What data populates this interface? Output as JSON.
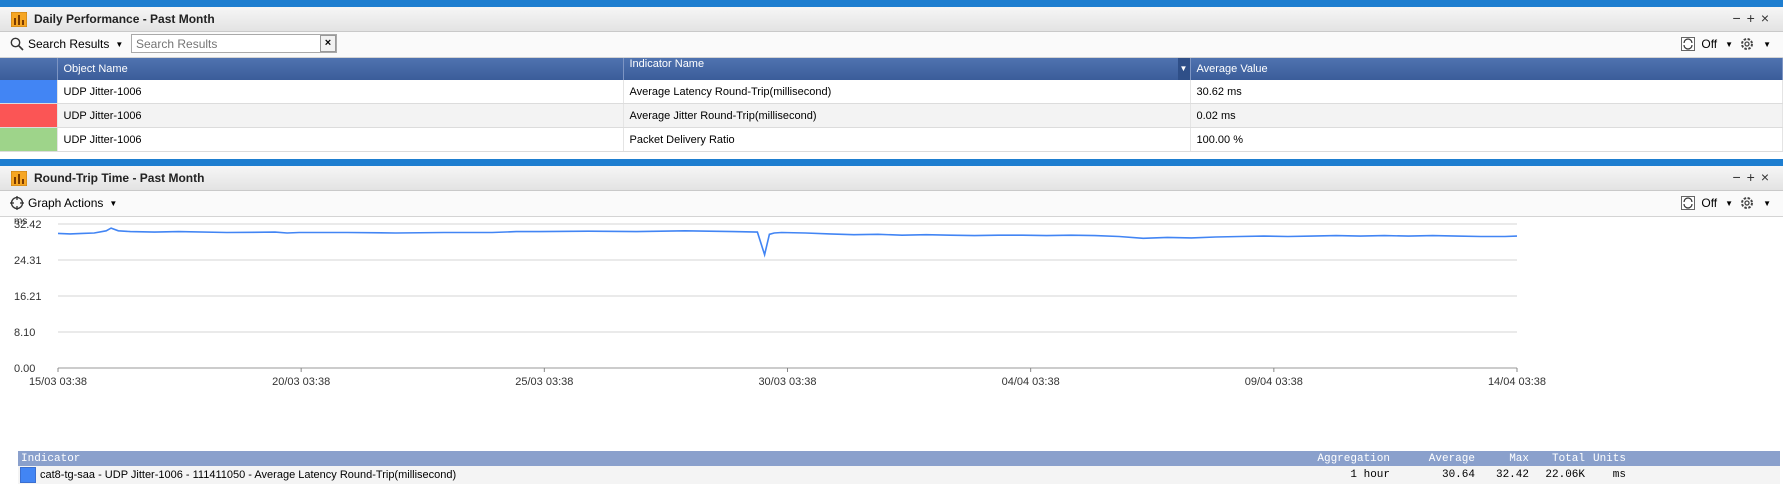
{
  "panel1": {
    "title": "Daily Performance - Past Month",
    "controls": [
      "−",
      "+",
      "×"
    ],
    "search_menu_label": "Search Results",
    "search_placeholder": "Search Results",
    "search_clear": "×",
    "refresh_label": "Off",
    "table": {
      "headers": [
        "Object Name",
        "Indicator Name",
        "Average Value"
      ],
      "rows": [
        {
          "color": "#4285f4",
          "object": "UDP Jitter-1006",
          "indicator": "Average Latency Round-Trip(millisecond)",
          "value": "30.62 ms"
        },
        {
          "color": "#fb5555",
          "object": "UDP Jitter-1006",
          "indicator": "Average Jitter Round-Trip(millisecond)",
          "value": "0.02 ms"
        },
        {
          "color": "#9ed48a",
          "object": "UDP Jitter-1006",
          "indicator": "Packet Delivery Ratio",
          "value": "100.00 %"
        }
      ]
    }
  },
  "panel2": {
    "title": "Round-Trip Time - Past Month",
    "controls": [
      "−",
      "+",
      "×"
    ],
    "graph_actions_label": "Graph Actions",
    "refresh_label": "Off",
    "legend": {
      "headers": {
        "indicator": "Indicator",
        "aggregation": "Aggregation",
        "average": "Average",
        "max": "Max",
        "total": "Total",
        "units": "Units"
      },
      "row": {
        "color": "#4285f4",
        "indicator": "cat8-tg-saa - UDP Jitter-1006 - 111411050 - Average Latency Round-Trip(millisecond)",
        "aggregation": "1 hour",
        "average": "30.64",
        "max": "32.42",
        "total": "22.06K",
        "units": "ms"
      }
    }
  },
  "chart_data": {
    "type": "line",
    "ylabel": "ms",
    "ylim": [
      0,
      32.42
    ],
    "y_ticks": [
      "0.00",
      "8.10",
      "16.21",
      "24.31",
      "32.42"
    ],
    "x_ticks": [
      "15/03 03:38",
      "20/03 03:38",
      "25/03 03:38",
      "30/03 03:38",
      "04/04 03:38",
      "09/04 03:38",
      "14/04 03:38"
    ],
    "series": [
      {
        "color": "#4285f4",
        "x": [
          0,
          0.5,
          1,
          1.5,
          2,
          2.2,
          2.5,
          3,
          4,
          5,
          7,
          9,
          9.5,
          10,
          12,
          14,
          16,
          18,
          19,
          20,
          22,
          24,
          25,
          26,
          27,
          28,
          29,
          29.3,
          29.5,
          29.7,
          30,
          31,
          32,
          33,
          34,
          35,
          36,
          37,
          38,
          39,
          40,
          41,
          42,
          43,
          44,
          45,
          46,
          47,
          48,
          49,
          50,
          51,
          52,
          53,
          54,
          55,
          56,
          57,
          58,
          59,
          60,
          60.5
        ],
        "y": [
          30.3,
          30.2,
          30.3,
          30.4,
          30.9,
          31.5,
          30.9,
          30.7,
          30.6,
          30.7,
          30.5,
          30.6,
          30.4,
          30.5,
          30.5,
          30.4,
          30.5,
          30.5,
          30.7,
          30.7,
          30.8,
          30.7,
          30.8,
          30.9,
          30.8,
          30.7,
          30.6,
          25.5,
          30.1,
          30.4,
          30.5,
          30.4,
          30.2,
          30.0,
          30.1,
          29.9,
          30.0,
          29.9,
          29.8,
          29.9,
          29.9,
          29.8,
          29.9,
          29.8,
          29.6,
          29.2,
          29.4,
          29.3,
          29.5,
          29.6,
          29.7,
          29.6,
          29.7,
          29.8,
          29.7,
          29.8,
          29.7,
          29.8,
          29.7,
          29.6,
          29.6,
          29.7
        ]
      }
    ]
  }
}
